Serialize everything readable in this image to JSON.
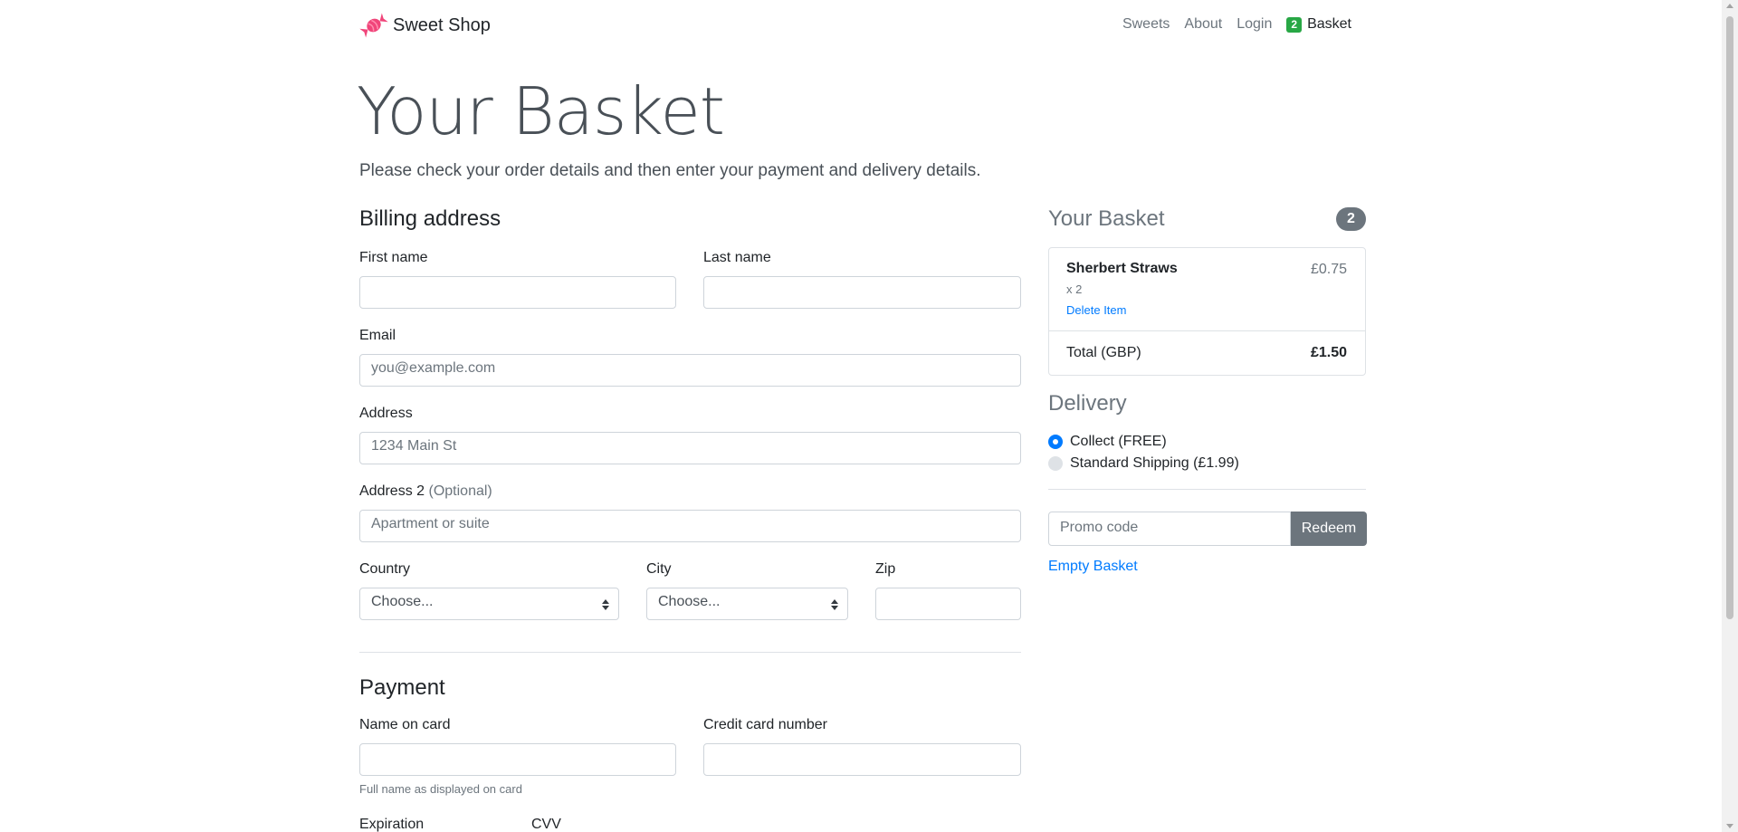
{
  "nav": {
    "brand": "Sweet Shop",
    "links": {
      "sweets": "Sweets",
      "about": "About",
      "login": "Login"
    },
    "basket_count": "2",
    "basket_label": "Basket"
  },
  "header": {
    "title": "Your Basket",
    "lead": "Please check your order details and then enter your payment and delivery details."
  },
  "billing": {
    "heading": "Billing address",
    "first_name_label": "First name",
    "first_name_value": "",
    "last_name_label": "Last name",
    "last_name_value": "",
    "email_label": "Email",
    "email_placeholder": "you@example.com",
    "address_label": "Address",
    "address_placeholder": "1234 Main St",
    "address2_label": "Address 2",
    "address2_optional": "(Optional)",
    "address2_placeholder": "Apartment or suite",
    "country_label": "Country",
    "country_value": "Choose...",
    "city_label": "City",
    "city_value": "Choose...",
    "zip_label": "Zip",
    "zip_value": ""
  },
  "payment": {
    "heading": "Payment",
    "name_on_card_label": "Name on card",
    "name_on_card_help": "Full name as displayed on card",
    "cc_number_label": "Credit card number",
    "expiration_label": "Expiration",
    "cvv_label": "CVV"
  },
  "basket": {
    "title": "Your Basket",
    "count": "2",
    "items": [
      {
        "name": "Sherbert Straws",
        "price": "£0.75",
        "qty": "x 2",
        "delete": "Delete Item"
      }
    ],
    "total_label": "Total (GBP)",
    "total_value": "£1.50"
  },
  "delivery": {
    "heading": "Delivery",
    "options": [
      {
        "label": "Collect (FREE)",
        "selected": true
      },
      {
        "label": "Standard Shipping (£1.99)",
        "selected": false
      }
    ]
  },
  "promo": {
    "placeholder": "Promo code",
    "button": "Redeem",
    "empty_basket": "Empty Basket"
  },
  "colors": {
    "brand_icon": "#f0457a",
    "primary": "#007bff",
    "secondary": "#6c757d",
    "success": "#28a745"
  }
}
